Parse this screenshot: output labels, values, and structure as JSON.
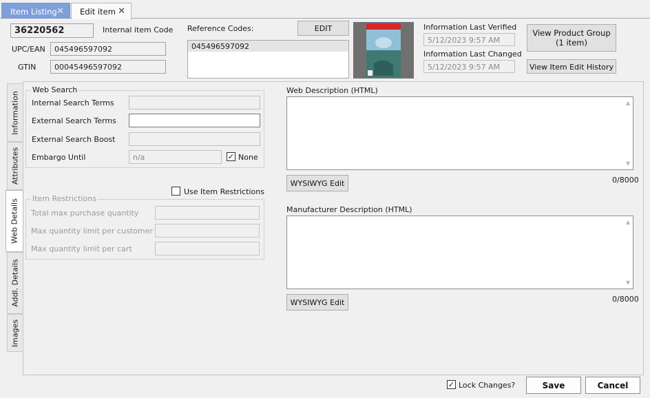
{
  "tabs": {
    "listing": "Item Listing",
    "edit": "Edit item"
  },
  "header": {
    "item_code": "36220562",
    "internal_item_code_label": "Internal item Code",
    "upc_label": "UPC/EAN",
    "upc_value": "045496597092",
    "gtin_label": "GTIN",
    "gtin_value": "00045496597092",
    "reference_codes_label": "Reference Codes:",
    "edit_button": "EDIT",
    "reference_codes": [
      "045496597092"
    ],
    "info_verified_label": "Information Last Verified",
    "info_verified_value": "5/12/2023 9:57 AM",
    "info_changed_label": "Information Last Changed",
    "info_changed_value": "5/12/2023 9:57 AM",
    "view_product_group_line1": "View Product Group",
    "view_product_group_line2": "(1 item)",
    "view_edit_history": "View Item Edit History"
  },
  "side_tabs": [
    "Information",
    "Attributes",
    "Web Details",
    "Addl. Details",
    "Images"
  ],
  "web_search": {
    "title": "Web Search",
    "internal_terms_label": "Internal Search Terms",
    "internal_terms_value": "",
    "external_terms_label": "External Search Terms",
    "external_terms_value": "",
    "external_boost_label": "External Search Boost",
    "external_boost_value": "",
    "embargo_label": "Embargo Until",
    "embargo_value": "n/a",
    "none_label": "None",
    "none_checked": true
  },
  "restrictions": {
    "use_label": "Use Item Restrictions",
    "use_checked": false,
    "title": "Item Restrictions",
    "total_max_label": "Total max purchase quantity",
    "max_per_customer_label": "Max quantity limit per customer",
    "max_per_cart_label": "Max quantity limit per cart"
  },
  "web_description": {
    "label": "Web Description (HTML)",
    "wysiwyg": "WYSIWYG Edit",
    "count": "0/8000"
  },
  "manufacturer_description": {
    "label": "Manufacturer Description (HTML)",
    "wysiwyg": "WYSIWYG Edit",
    "count": "0/8000"
  },
  "footer": {
    "lock_label": "Lock Changes?",
    "lock_checked": true,
    "save": "Save",
    "cancel": "Cancel"
  }
}
